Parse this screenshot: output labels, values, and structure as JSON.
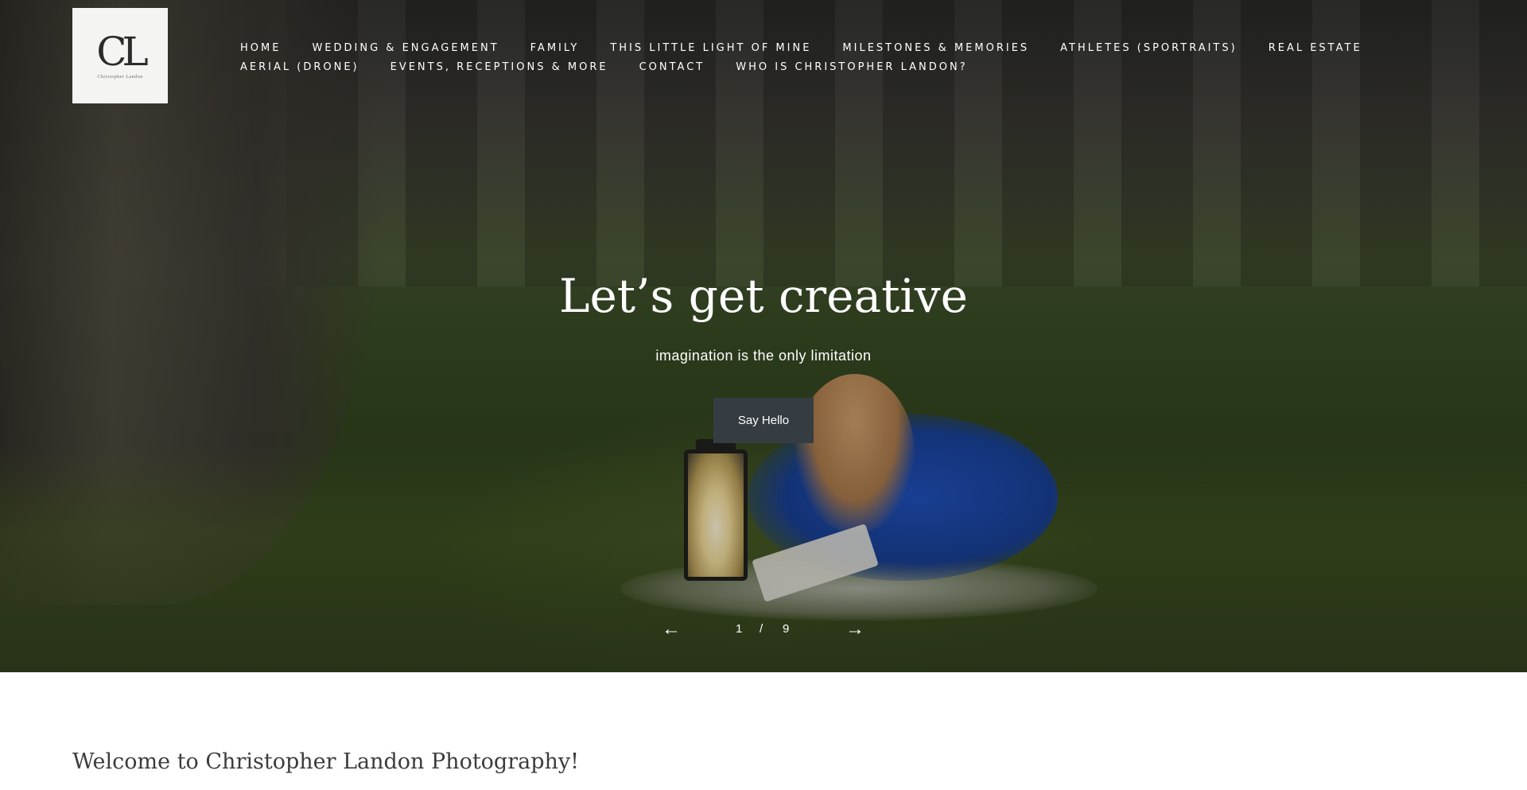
{
  "header": {
    "logo_mark": "CL",
    "logo_sub": "Christopher Landon",
    "nav_row1": [
      "HOME",
      "WEDDING & ENGAGEMENT",
      "FAMILY",
      "THIS LITTLE LIGHT OF MINE",
      "MILESTONES & MEMORIES",
      "ATHLETES (SPORTRAITS)",
      "REAL ESTATE"
    ],
    "nav_row2": [
      "AERIAL (DRONE)",
      "EVENTS, RECEPTIONS & MORE",
      "CONTACT",
      "WHO IS CHRISTOPHER LANDON?"
    ]
  },
  "hero": {
    "title": "Let’s get creative",
    "subtitle": "imagination is the only limitation",
    "cta_label": "Say Hello",
    "slider": {
      "prev_icon": "arrow-left-icon",
      "next_icon": "arrow-right-icon",
      "prev_glyph": "←",
      "next_glyph": "→",
      "current": "1",
      "separator": "/",
      "total": "9"
    }
  },
  "welcome": {
    "heading": "Welcome to Christopher Landon Photography!"
  },
  "colors": {
    "cta_bg": "#353d42",
    "text_light": "#ffffff",
    "heading_dark": "#3c3c3c"
  }
}
